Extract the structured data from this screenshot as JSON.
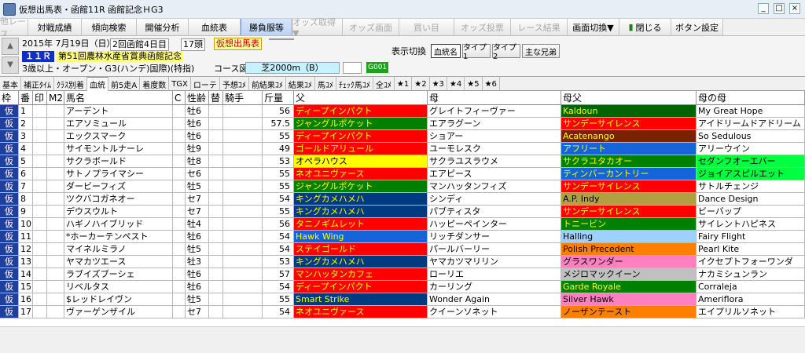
{
  "window": {
    "title": "仮想出馬表・函館11R 函館記念ＨG3"
  },
  "toolbar": [
    {
      "label": "他レース",
      "disabled": true,
      "w": 36
    },
    {
      "label": "対戦成績",
      "disabled": false,
      "w": 68
    },
    {
      "label": "傾向検索",
      "disabled": false,
      "w": 70
    },
    {
      "label": "開催分析",
      "disabled": false,
      "w": 66
    },
    {
      "label": "血統表",
      "disabled": false,
      "w": 66
    },
    {
      "label": "勝負服等",
      "disabled": false,
      "w": 66,
      "selected": true
    },
    {
      "label": "オッズ取得▼",
      "disabled": true,
      "w": 64
    },
    {
      "label": "オッズ画面",
      "disabled": true,
      "w": 72
    },
    {
      "label": "買い目",
      "disabled": true,
      "w": 70
    },
    {
      "label": "オッズ投票",
      "disabled": true,
      "w": 72
    },
    {
      "label": "レース結果",
      "disabled": true,
      "w": 72
    },
    {
      "label": "画面切換▼",
      "disabled": false,
      "w": 66
    },
    {
      "label": "閉じる",
      "disabled": false,
      "w": 66,
      "icon": true
    },
    {
      "label": "ボタン設定",
      "disabled": false,
      "w": 66
    }
  ],
  "race": {
    "date": "2015年 7月19日（日）",
    "meeting": "2回函館4日目",
    "heads": "17頭",
    "virtual_badge": "仮想出馬表",
    "race_no": "１１Ｒ",
    "race_name": "第51回農林水産省賞典函館記念",
    "conditions": "3歳以上・オープン・G3(ハンデ)国際)(特指)",
    "course_label": "コース図",
    "course": "芝2000m（B）",
    "g_code": "G001"
  },
  "display": {
    "label": "表示切換",
    "buttons": [
      "血統名",
      "タイプ1",
      "タイプ2",
      "主な兄弟"
    ],
    "selected": "血統名"
  },
  "tabs": [
    "基本",
    "補正ﾀｲﾑ",
    "ｸﾗｽ別着",
    "血統",
    "前5走A",
    "着度数",
    "TGX",
    "ローテ",
    "予想ｺﾒ",
    "前結果ｺﾒ",
    "結果ｺﾒ",
    "馬ｺﾒ",
    "ﾁｪｯｸ馬ｺﾒ",
    "全ｺﾒ",
    "★1",
    "★2",
    "★3",
    "★4",
    "★5",
    "★6"
  ],
  "tab_selected": "血統",
  "columns": {
    "waku": "枠",
    "ban": "番",
    "mark": "印",
    "m2": "M2",
    "name": "馬名",
    "c": "C",
    "sexage": "性齢",
    "jockey_flag": "替",
    "jockey": "騎手",
    "weight": "斤量",
    "sire": "父",
    "dam": "母",
    "bms": "母父",
    "damdam": "母の母"
  },
  "colors": {
    "red": "#ff0000",
    "green": "#008000",
    "yellow": "#ffff00",
    "navy": "#003a80",
    "blue": "#1565d8",
    "orange": "#ff8000",
    "magenta": "#ff00ff",
    "pink": "#ff80c0",
    "lime": "#00ff40",
    "darkred": "#8b0000",
    "brown": "#7a2200",
    "bluegreen": "#008080",
    "ltblue": "#a0d0ff",
    "cyan": "#00ffff",
    "gray": "#c0c0c0",
    "white": "#ffffff",
    "purple": "#800080",
    "darkgreen": "#006400"
  },
  "horses": [
    {
      "waku": "仮",
      "ban": "1",
      "name": "アーデント",
      "sexage": "牡6",
      "weight": "56",
      "sire": "ディープインパクト",
      "sire_c": "red",
      "dam": "グレイトフィーヴァー",
      "dam_c": "white",
      "bms": "Kaldoun",
      "bms_c": "darkgreen",
      "damdam": "My Great Hope",
      "damdam_c": "white"
    },
    {
      "waku": "仮",
      "ban": "2",
      "name": "エアソミュール",
      "sexage": "牡6",
      "weight": "57.5",
      "sire": "ジャングルポケット",
      "sire_c": "green",
      "dam": "エアラグーン",
      "dam_c": "white",
      "bms": "サンデーサイレンス",
      "bms_c": "red",
      "damdam": "アイドリームドアドリーム",
      "damdam_c": "white"
    },
    {
      "waku": "仮",
      "ban": "3",
      "name": "エックスマーク",
      "sexage": "牡6",
      "weight": "55",
      "sire": "ディープインパクト",
      "sire_c": "red",
      "dam": "ショアー",
      "dam_c": "white",
      "bms": "Acatenango",
      "bms_c": "brown",
      "damdam": "So Sedulous",
      "damdam_c": "white"
    },
    {
      "waku": "仮",
      "ban": "4",
      "name": "サイモントルナーレ",
      "sexage": "牡9",
      "weight": "49",
      "sire": "ゴールドアリュール",
      "sire_c": "red",
      "dam": "ユーモレスク",
      "dam_c": "white",
      "bms": "アフリート",
      "bms_c": "blue",
      "damdam": "アリーウイン",
      "damdam_c": "white"
    },
    {
      "waku": "仮",
      "ban": "5",
      "name": "サクラボールド",
      "sexage": "牡8",
      "weight": "53",
      "sire": "オペラハウス",
      "sire_c": "yellow",
      "dam": "サクラユスラウメ",
      "dam_c": "white",
      "bms": "サクラユタカオー",
      "bms_c": "green",
      "damdam": "セダンフオーエバー",
      "damdam_c": "lime"
    },
    {
      "waku": "仮",
      "ban": "6",
      "name": "サトノプライマシー",
      "sexage": "セ6",
      "weight": "55",
      "sire": "ネオユニヴァース",
      "sire_c": "red",
      "dam": "エアピース",
      "dam_c": "white",
      "bms": "ティンバーカントリー",
      "bms_c": "blue",
      "damdam": "ジョイアスピルエット",
      "damdam_c": "lime"
    },
    {
      "waku": "仮",
      "ban": "7",
      "name": "ダービーフィズ",
      "sexage": "牡5",
      "weight": "55",
      "sire": "ジャングルポケット",
      "sire_c": "green",
      "dam": "マンハッタンフィズ",
      "dam_c": "white",
      "bms": "サンデーサイレンス",
      "bms_c": "red",
      "damdam": "サトルチェンジ",
      "damdam_c": "white"
    },
    {
      "waku": "仮",
      "ban": "8",
      "name": "ツクバコガネオー",
      "sexage": "セ7",
      "weight": "54",
      "sire": "キングカメハメハ",
      "sire_c": "navy",
      "dam": "シンディ",
      "dam_c": "white",
      "bms": "A.P. Indy",
      "bms_c": "darkred",
      "damdam": "Dance Design",
      "damdam_c": "white"
    },
    {
      "waku": "仮",
      "ban": "9",
      "name": "デウスウルト",
      "sexage": "セ7",
      "weight": "55",
      "sire": "キングカメハメハ",
      "sire_c": "navy",
      "dam": "パブティスタ",
      "dam_c": "white",
      "bms": "サンデーサイレンス",
      "bms_c": "red",
      "damdam": "ビーバップ",
      "damdam_c": "white"
    },
    {
      "waku": "仮",
      "ban": "10",
      "name": "ハギノハイブリッド",
      "sexage": "牡4",
      "weight": "56",
      "sire": "タニノギムレット",
      "sire_c": "red",
      "dam": "ハッピーペインター",
      "dam_c": "white",
      "bms": "トニービン",
      "bms_c": "green",
      "damdam": "サイレントハピネス",
      "damdam_c": "white"
    },
    {
      "waku": "仮",
      "ban": "11",
      "name": "*ホーカーテンペスト",
      "sexage": "牡6",
      "weight": "54",
      "sire": "Hawk Wing",
      "sire_c": "blue",
      "dam": "リッチダンサー",
      "dam_c": "white",
      "bms": "Halling",
      "bms_c": "ltblue",
      "damdam": "Fairy Flight",
      "damdam_c": "white"
    },
    {
      "waku": "仮",
      "ban": "12",
      "name": "マイネルミラノ",
      "sexage": "牡5",
      "weight": "54",
      "sire": "ステイゴールド",
      "sire_c": "red",
      "dam": "パールバーリー",
      "dam_c": "white",
      "bms": "Polish Precedent",
      "bms_c": "orange",
      "damdam": "Pearl Kite",
      "damdam_c": "white"
    },
    {
      "waku": "仮",
      "ban": "13",
      "name": "ヤマカツエース",
      "sexage": "牡3",
      "weight": "53",
      "sire": "キングカメハメハ",
      "sire_c": "navy",
      "dam": "ヤマカツマリリン",
      "dam_c": "white",
      "bms": "グラスワンダー",
      "bms_c": "pink",
      "damdam": "イクセプトフォーワンダ",
      "damdam_c": "white"
    },
    {
      "waku": "仮",
      "ban": "14",
      "name": "ラブイズブーシェ",
      "sexage": "牡6",
      "weight": "57",
      "sire": "マンハッタンカフェ",
      "sire_c": "red",
      "dam": "ローリエ",
      "dam_c": "white",
      "bms": "メジロマックイーン",
      "bms_c": "gray",
      "damdam": "ナカミシュンラン",
      "damdam_c": "white"
    },
    {
      "waku": "仮",
      "ban": "15",
      "name": "リベルタス",
      "sexage": "牡6",
      "weight": "54",
      "sire": "ディープインパクト",
      "sire_c": "red",
      "dam": "カーリング",
      "dam_c": "white",
      "bms": "Garde Royale",
      "bms_c": "green",
      "damdam": "Corraleja",
      "damdam_c": "white"
    },
    {
      "waku": "仮",
      "ban": "16",
      "name": "$レッドレイヴン",
      "sexage": "牡5",
      "weight": "55",
      "sire": "Smart Strike",
      "sire_c": "navy",
      "dam": "Wonder Again",
      "dam_c": "white",
      "bms": "Silver Hawk",
      "bms_c": "pink",
      "damdam": "Ameriflora",
      "damdam_c": "white"
    },
    {
      "waku": "仮",
      "ban": "17",
      "name": "ヴァーゲンザイル",
      "sexage": "セ7",
      "weight": "54",
      "sire": "ネオユニヴァース",
      "sire_c": "red",
      "dam": "クイーンソネット",
      "dam_c": "white",
      "bms": "ノーザンテースト",
      "bms_c": "orange",
      "damdam": "エイプリルソネット",
      "damdam_c": "white"
    }
  ]
}
